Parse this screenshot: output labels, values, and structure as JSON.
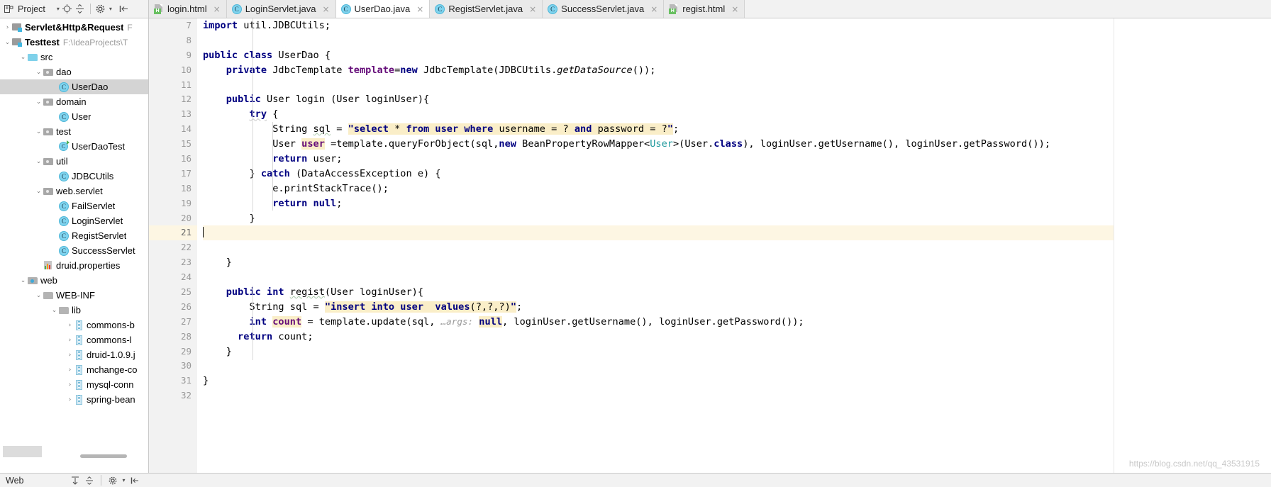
{
  "toolbar": {
    "project_label": "Project",
    "caret": "▾",
    "icons": [
      "project-panel-icon",
      "locate-icon",
      "collapse-all-icon",
      "settings-icon",
      "hide-icon"
    ]
  },
  "tabs": [
    {
      "label": "login.html",
      "type": "html",
      "active": false
    },
    {
      "label": "LoginServlet.java",
      "type": "class",
      "active": false
    },
    {
      "label": "UserDao.java",
      "type": "class",
      "active": true
    },
    {
      "label": "RegistServlet.java",
      "type": "class",
      "active": false
    },
    {
      "label": "SuccessServlet.java",
      "type": "class",
      "active": false
    },
    {
      "label": "regist.html",
      "type": "html",
      "active": false
    }
  ],
  "tab_close_glyph": "×",
  "sidebar": {
    "items": [
      {
        "label": "Servlet&Http&Request",
        "path": "F",
        "indent": 0,
        "arrow": "›",
        "icon": "module-icon",
        "bold": true,
        "selected": false
      },
      {
        "label": "Testtest",
        "path": "F:\\IdeaProjects\\T",
        "indent": 0,
        "arrow": "⌄",
        "icon": "module-icon",
        "bold": true,
        "selected": false
      },
      {
        "label": "src",
        "path": "",
        "indent": 1,
        "arrow": "⌄",
        "icon": "source-folder-icon",
        "bold": false,
        "selected": false
      },
      {
        "label": "dao",
        "path": "",
        "indent": 2,
        "arrow": "⌄",
        "icon": "package-folder-icon",
        "bold": false,
        "selected": false
      },
      {
        "label": "UserDao",
        "path": "",
        "indent": 3,
        "arrow": "",
        "icon": "java-class-icon",
        "bold": false,
        "selected": true
      },
      {
        "label": "domain",
        "path": "",
        "indent": 2,
        "arrow": "⌄",
        "icon": "package-folder-icon",
        "bold": false,
        "selected": false
      },
      {
        "label": "User",
        "path": "",
        "indent": 3,
        "arrow": "",
        "icon": "java-class-icon",
        "bold": false,
        "selected": false
      },
      {
        "label": "test",
        "path": "",
        "indent": 2,
        "arrow": "⌄",
        "icon": "package-folder-icon",
        "bold": false,
        "selected": false
      },
      {
        "label": "UserDaoTest",
        "path": "",
        "indent": 3,
        "arrow": "",
        "icon": "java-test-class-icon",
        "bold": false,
        "selected": false
      },
      {
        "label": "util",
        "path": "",
        "indent": 2,
        "arrow": "⌄",
        "icon": "package-folder-icon",
        "bold": false,
        "selected": false
      },
      {
        "label": "JDBCUtils",
        "path": "",
        "indent": 3,
        "arrow": "",
        "icon": "java-class-icon",
        "bold": false,
        "selected": false
      },
      {
        "label": "web.servlet",
        "path": "",
        "indent": 2,
        "arrow": "⌄",
        "icon": "package-folder-icon",
        "bold": false,
        "selected": false
      },
      {
        "label": "FailServlet",
        "path": "",
        "indent": 3,
        "arrow": "",
        "icon": "java-class-icon",
        "bold": false,
        "selected": false
      },
      {
        "label": "LoginServlet",
        "path": "",
        "indent": 3,
        "arrow": "",
        "icon": "java-class-icon",
        "bold": false,
        "selected": false
      },
      {
        "label": "RegistServlet",
        "path": "",
        "indent": 3,
        "arrow": "",
        "icon": "java-class-icon",
        "bold": false,
        "selected": false
      },
      {
        "label": "SuccessServlet",
        "path": "",
        "indent": 3,
        "arrow": "",
        "icon": "java-class-icon",
        "bold": false,
        "selected": false
      },
      {
        "label": "druid.properties",
        "path": "",
        "indent": 2,
        "arrow": "",
        "icon": "properties-file-icon",
        "bold": false,
        "selected": false
      },
      {
        "label": "web",
        "path": "",
        "indent": 1,
        "arrow": "⌄",
        "icon": "web-folder-icon",
        "bold": false,
        "selected": false
      },
      {
        "label": "WEB-INF",
        "path": "",
        "indent": 2,
        "arrow": "⌄",
        "icon": "folder-icon",
        "bold": false,
        "selected": false
      },
      {
        "label": "lib",
        "path": "",
        "indent": 3,
        "arrow": "⌄",
        "icon": "folder-icon",
        "bold": false,
        "selected": false
      },
      {
        "label": "commons-b",
        "path": "",
        "indent": 4,
        "arrow": "›",
        "icon": "jar-icon",
        "bold": false,
        "selected": false
      },
      {
        "label": "commons-l",
        "path": "",
        "indent": 4,
        "arrow": "›",
        "icon": "jar-icon",
        "bold": false,
        "selected": false
      },
      {
        "label": "druid-1.0.9.j",
        "path": "",
        "indent": 4,
        "arrow": "›",
        "icon": "jar-icon",
        "bold": false,
        "selected": false
      },
      {
        "label": "mchange-co",
        "path": "",
        "indent": 4,
        "arrow": "›",
        "icon": "jar-icon",
        "bold": false,
        "selected": false
      },
      {
        "label": "mysql-conn",
        "path": "",
        "indent": 4,
        "arrow": "›",
        "icon": "jar-icon",
        "bold": false,
        "selected": false
      },
      {
        "label": "spring-bean",
        "path": "",
        "indent": 4,
        "arrow": "›",
        "icon": "jar-icon",
        "bold": false,
        "selected": false
      }
    ]
  },
  "editor": {
    "file": "UserDao.java",
    "first_line_number": 7,
    "last_line_number": 32,
    "current_line": 21,
    "lines": [
      {
        "n": 7,
        "fold": "tag"
      },
      {
        "n": 8,
        "fold": ""
      },
      {
        "n": 9,
        "fold": ""
      },
      {
        "n": 10,
        "fold": ""
      },
      {
        "n": 11,
        "fold": ""
      },
      {
        "n": 12,
        "fold": "sq"
      },
      {
        "n": 13,
        "fold": ""
      },
      {
        "n": 14,
        "fold": ""
      },
      {
        "n": 15,
        "fold": ""
      },
      {
        "n": 16,
        "fold": ""
      },
      {
        "n": 17,
        "fold": ""
      },
      {
        "n": 18,
        "fold": ""
      },
      {
        "n": 19,
        "fold": ""
      },
      {
        "n": 20,
        "fold": ""
      },
      {
        "n": 21,
        "fold": ""
      },
      {
        "n": 22,
        "fold": ""
      },
      {
        "n": 23,
        "fold": "tag"
      },
      {
        "n": 24,
        "fold": ""
      },
      {
        "n": 25,
        "fold": "sq"
      },
      {
        "n": 26,
        "fold": ""
      },
      {
        "n": 27,
        "fold": ""
      },
      {
        "n": 28,
        "fold": ""
      },
      {
        "n": 29,
        "fold": "tag"
      },
      {
        "n": 30,
        "fold": ""
      },
      {
        "n": 31,
        "fold": ""
      },
      {
        "n": 32,
        "fold": ""
      }
    ],
    "source": {
      "l7": "import util.JDBCUtils;",
      "l9": "public class UserDao {",
      "l10": "    private JdbcTemplate template=new JdbcTemplate(JDBCUtils.getDataSource());",
      "l12": "    public User login (User loginUser){",
      "l13": "        try {",
      "l14": "            String sql = \"select * from user where username = ? and password = ?\";",
      "l15": "            User user =template.queryForObject(sql,new BeanPropertyRowMapper<User>(User.class), loginUser.getUsername(), loginUser.getPassword());",
      "l16": "            return user;",
      "l17": "        } catch (DataAccessException e) {",
      "l18": "            e.printStackTrace();",
      "l19": "            return null;",
      "l20": "        }",
      "l23": "    }",
      "l25": "    public int regist(User loginUser){",
      "l26": "        String sql = \"insert into user  values(?,?,?)\";",
      "l27": "        int count = template.update(sql,  ...args: null, loginUser.getUsername(), loginUser.getPassword());",
      "l28": "      return count;",
      "l29": "    }",
      "l31": "}"
    },
    "param_hint": "…args:",
    "watermark": "https://blog.csdn.net/qq_43531915"
  },
  "statusbar": {
    "label": "Web",
    "icons": [
      "expand-icon",
      "collapse-icon",
      "settings-icon",
      "hide-icon"
    ]
  },
  "colors": {
    "keyword": "#000080",
    "string": "#008000",
    "field": "#660e7a",
    "generic": "#20999d",
    "sql_highlight": "#faeec8",
    "selection": "#d4d4d4",
    "current_line": "#fdf6e3",
    "gutter_bg": "#f2f2f2",
    "toolbar_bg": "#f2f2f2",
    "class_icon": "#7fd3ee"
  }
}
